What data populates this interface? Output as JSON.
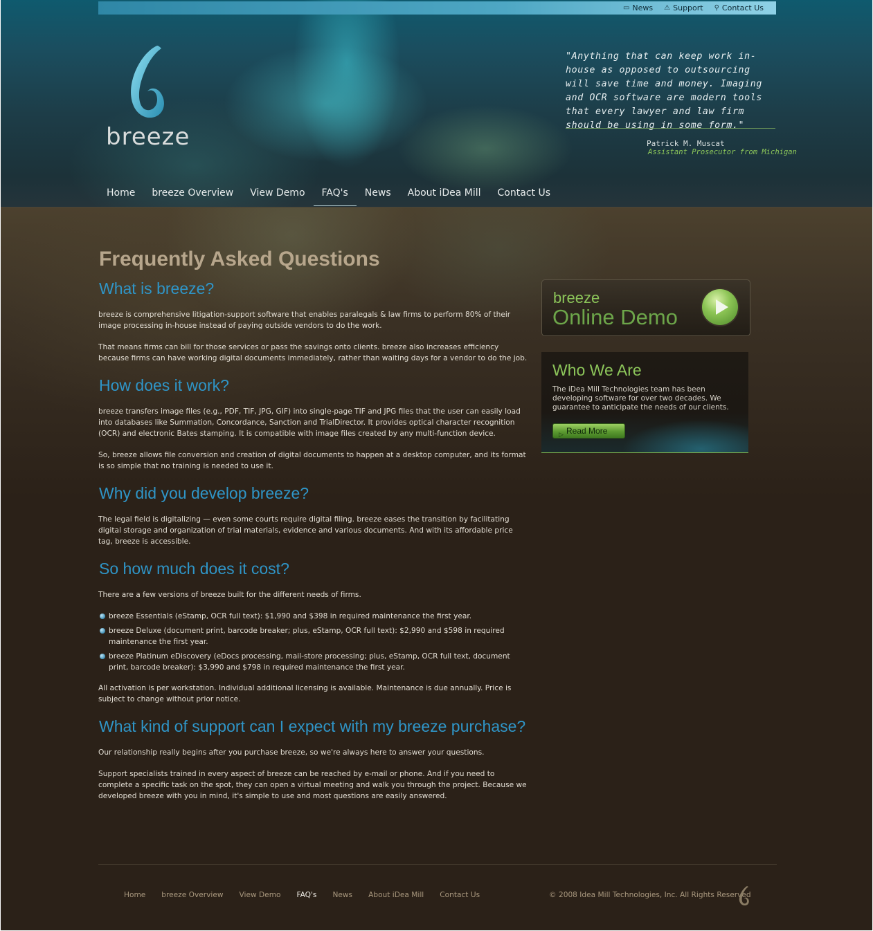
{
  "util_nav": [
    {
      "label": "News",
      "icon": "speech-bubble-icon"
    },
    {
      "label": "Support",
      "icon": "warning-triangle-icon"
    },
    {
      "label": "Contact Us",
      "icon": "person-icon"
    }
  ],
  "brand": {
    "name": "breeze",
    "logo_color": "#4fb4cf"
  },
  "quote": {
    "text": "\"Anything that can keep work in-house as opposed to outsourcing will save time and money. Imaging and OCR software are modern tools that every lawyer and law firm should be using in some form.\"",
    "author": "Patrick M. Muscat",
    "role": "Assistant Prosecutor from Michigan"
  },
  "main_nav": [
    {
      "label": "Home"
    },
    {
      "label": "breeze Overview"
    },
    {
      "label": "View Demo"
    },
    {
      "label": "FAQ's",
      "active": true
    },
    {
      "label": "News"
    },
    {
      "label": "About iDea Mill"
    },
    {
      "label": "Contact Us"
    }
  ],
  "page": {
    "title": "Frequently Asked Questions",
    "sections": {
      "what": {
        "heading": "What is breeze?",
        "p1": "breeze is comprehensive litigation-support software that enables paralegals & law firms to perform 80% of their image processing in-house instead of paying outside vendors to do the work.",
        "p2": "That means firms can bill for those services or pass the savings onto clients. breeze also increases efficiency because firms can have working digital documents immediately, rather than waiting days for a vendor to do the job."
      },
      "how": {
        "heading": "How does it work?",
        "p1": "breeze transfers image files (e.g., PDF, TIF, JPG, GIF) into single-page TIF and JPG files that the user can easily load into databases like Summation, Concordance, Sanction and TrialDirector. It provides optical character recognition (OCR) and electronic Bates stamping. It is compatible with image files created by any multi-function device.",
        "p2": "So, breeze allows file conversion and creation of digital documents to happen at a desktop computer, and its format is so simple that no training is needed to use it."
      },
      "why": {
        "heading": "Why did you develop breeze?",
        "p1": "The legal field is digitalizing — even some courts require digital filing. breeze eases the transition by facilitating digital storage and organization of trial materials, evidence and various documents. And with its affordable price tag, breeze is accessible."
      },
      "cost": {
        "heading": "So how much does it cost?",
        "intro": "There are a few versions of breeze built for the different needs of firms.",
        "items": [
          "breeze Essentials (eStamp, OCR full text): $1,990 and $398 in required maintenance the first year.",
          "breeze Deluxe (document print, barcode breaker; plus, eStamp, OCR full text): $2,990 and $598 in required maintenance the first year.",
          "breeze Platinum eDiscovery (eDocs processing, mail-store processing; plus, eStamp, OCR full text, document print, barcode breaker): $3,990 and $798 in required maintenance the first year."
        ],
        "note": "All activation is per workstation. Individual additional licensing is available. Maintenance is due annually. Price is subject to change without prior notice."
      },
      "support": {
        "heading": "What kind of support can I expect with my breeze purchase?",
        "p1": "Our relationship really begins after you purchase breeze, so we're always here to answer your questions.",
        "p2": "Support specialists trained in every aspect of breeze can be reached by e-mail or phone. And if you need to complete a specific task on the spot, they can open a virtual meeting and walk you through the project. Because we developed breeze with you in mind, it's simple to use and most questions are easily answered."
      }
    }
  },
  "sidebar": {
    "demo": {
      "small": "breeze",
      "big": "Online Demo",
      "icon": "play-icon"
    },
    "who": {
      "title": "Who We Are",
      "text": "The iDea Mill Technologies team has been developing software for over two decades. We guarantee to anticipate the needs of our clients.",
      "button": "Read More"
    }
  },
  "footer": {
    "nav": [
      {
        "label": "Home"
      },
      {
        "label": "breeze Overview"
      },
      {
        "label": "View Demo"
      },
      {
        "label": "FAQ's",
        "active": true
      },
      {
        "label": "News"
      },
      {
        "label": "About iDea Mill"
      },
      {
        "label": "Contact Us"
      }
    ],
    "copyright": "© 2008 Idea Mill Technologies, Inc. All Rights Reserved"
  },
  "colors": {
    "heading_blue": "#2f95c7",
    "accent_green": "#8cc55a",
    "title_tan": "#b7a68c",
    "body_bg": "#2b2118"
  }
}
